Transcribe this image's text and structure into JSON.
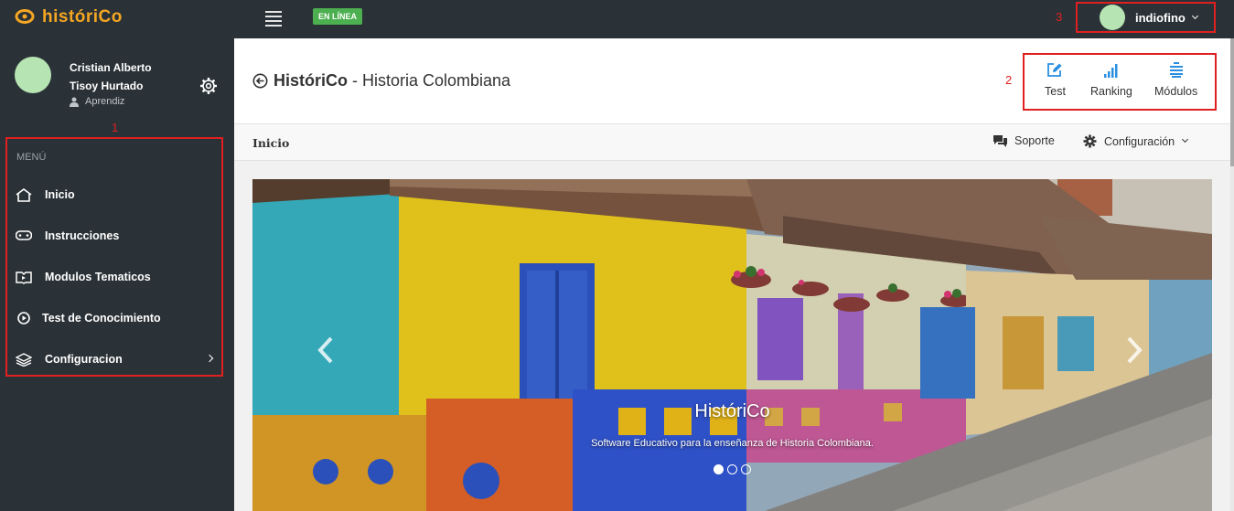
{
  "app": {
    "logo_text": "históriCo",
    "online_badge": "EN LÍNEA"
  },
  "user_menu": {
    "username": "indiofino",
    "marker": "3"
  },
  "sidebar": {
    "profile": {
      "name": "Cristian Alberto Tisoy Hurtado",
      "role": "Aprendiz"
    },
    "marker": "1",
    "menu_title": "MENÚ",
    "items": [
      {
        "label": "Inicio",
        "icon": "home-icon"
      },
      {
        "label": "Instrucciones",
        "icon": "gamepad-icon"
      },
      {
        "label": "Modulos Tematicos",
        "icon": "book-icon"
      },
      {
        "label": "Test de Conocimiento",
        "icon": "play-circle-icon"
      },
      {
        "label": "Configuracion",
        "icon": "layers-icon"
      }
    ]
  },
  "header": {
    "title_brand": "HistóriCo",
    "title_rest": "- Historia Colombiana",
    "marker": "2",
    "actions": [
      {
        "label": "Test",
        "icon": "edit-icon"
      },
      {
        "label": "Ranking",
        "icon": "signal-bars-icon"
      },
      {
        "label": "Módulos",
        "icon": "list-icon"
      }
    ]
  },
  "subbar": {
    "breadcrumb": "Inicio",
    "support_label": "Soporte",
    "config_label": "Configuración"
  },
  "carousel": {
    "title": "HistóriCo",
    "subtitle": "Software Educativo para la enseñanza de Historia Colombiana.",
    "slides_count": 3,
    "active_slide": 1
  },
  "colors": {
    "accent": "#f5a623",
    "online": "#4caf50",
    "topbar": "#2b3237",
    "highlight": "#e02020",
    "action_icon": "#2a8fe0"
  }
}
